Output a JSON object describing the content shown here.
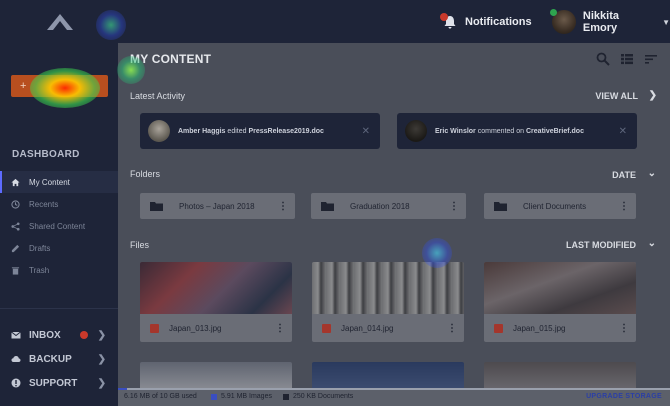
{
  "header": {
    "notifications_label": "Notifications",
    "user_name": "Nikkita Emory"
  },
  "sidebar": {
    "new_button_label": "+",
    "section_title": "DASHBOARD",
    "items": [
      {
        "label": "My Content",
        "icon": "home-icon"
      },
      {
        "label": "Recents",
        "icon": "clock-icon"
      },
      {
        "label": "Shared Content",
        "icon": "share-icon"
      },
      {
        "label": "Drafts",
        "icon": "drafts-icon"
      },
      {
        "label": "Trash",
        "icon": "trash-icon"
      }
    ],
    "bottom": [
      {
        "label": "INBOX",
        "icon": "mail-icon"
      },
      {
        "label": "BACKUP",
        "icon": "cloud-icon"
      },
      {
        "label": "SUPPORT",
        "icon": "support-icon"
      }
    ]
  },
  "main": {
    "title": "MY CONTENT",
    "latest_activity_label": "Latest Activity",
    "view_all_label": "VIEW ALL",
    "activity": [
      {
        "user": "Amber Haggis",
        "action": "edited",
        "target": "PressRelease2019.doc"
      },
      {
        "user": "Eric Winslor",
        "action": "commented on",
        "target": "CreativeBrief.doc"
      }
    ],
    "folders_label": "Folders",
    "folders_sort": "DATE",
    "folders": [
      "Photos – Japan 2018",
      "Graduation 2018",
      "Client Documents"
    ],
    "files_label": "Files",
    "files_sort": "LAST MODIFIED",
    "files": [
      "Japan_013.jpg",
      "Japan_014.jpg",
      "Japan_015.jpg"
    ]
  },
  "storage": {
    "used": "6.16 MB of 10 GB used",
    "images": "5.91 MB Images",
    "documents": "250 KB Documents",
    "upgrade": "UPGRADE STORAGE",
    "fraction_used": 0.016
  },
  "colors": {
    "accent": "#b84f1f",
    "sidebar_bg": "#1e2438",
    "storage_fill": "#3a4ec0"
  }
}
